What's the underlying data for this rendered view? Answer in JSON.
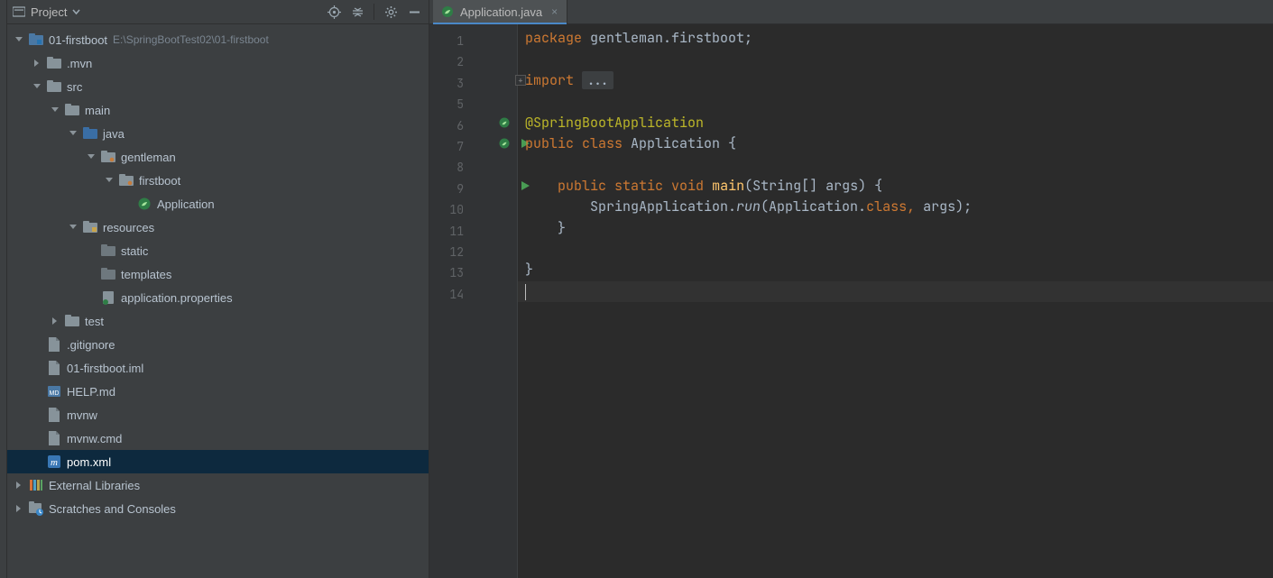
{
  "sidebar": {
    "title": "Project",
    "items": [
      {
        "depth": 0,
        "arrow": "down",
        "icon": "module",
        "label": "01-firstboot",
        "sub": "E:\\SpringBootTest02\\01-firstboot"
      },
      {
        "depth": 1,
        "arrow": "right",
        "icon": "folder",
        "label": ".mvn"
      },
      {
        "depth": 1,
        "arrow": "down",
        "icon": "folder",
        "label": "src"
      },
      {
        "depth": 2,
        "arrow": "down",
        "icon": "folder",
        "label": "main"
      },
      {
        "depth": 3,
        "arrow": "down",
        "icon": "src-folder",
        "label": "java"
      },
      {
        "depth": 4,
        "arrow": "down",
        "icon": "package",
        "label": "gentleman"
      },
      {
        "depth": 5,
        "arrow": "down",
        "icon": "package",
        "label": "firstboot"
      },
      {
        "depth": 6,
        "arrow": "none",
        "icon": "spring-class",
        "label": "Application"
      },
      {
        "depth": 3,
        "arrow": "down",
        "icon": "res-folder",
        "label": "resources"
      },
      {
        "depth": 4,
        "arrow": "none",
        "icon": "folder-dim",
        "label": "static"
      },
      {
        "depth": 4,
        "arrow": "none",
        "icon": "folder-dim",
        "label": "templates"
      },
      {
        "depth": 4,
        "arrow": "none",
        "icon": "spring-props",
        "label": "application.properties"
      },
      {
        "depth": 2,
        "arrow": "right",
        "icon": "folder",
        "label": "test"
      },
      {
        "depth": 1,
        "arrow": "none",
        "icon": "file",
        "label": ".gitignore"
      },
      {
        "depth": 1,
        "arrow": "none",
        "icon": "file",
        "label": "01-firstboot.iml"
      },
      {
        "depth": 1,
        "arrow": "none",
        "icon": "md",
        "label": "HELP.md"
      },
      {
        "depth": 1,
        "arrow": "none",
        "icon": "file",
        "label": "mvnw"
      },
      {
        "depth": 1,
        "arrow": "none",
        "icon": "file",
        "label": "mvnw.cmd"
      },
      {
        "depth": 1,
        "arrow": "none",
        "icon": "maven",
        "label": "pom.xml",
        "selected": true
      },
      {
        "depth": 0,
        "arrow": "right",
        "icon": "libs",
        "label": "External Libraries"
      },
      {
        "depth": 0,
        "arrow": "right",
        "icon": "scratch",
        "label": "Scratches and Consoles"
      }
    ]
  },
  "tab": {
    "file": "Application.java"
  },
  "code": {
    "lines": [
      1,
      2,
      3,
      5,
      6,
      7,
      8,
      9,
      10,
      11,
      12,
      13,
      14
    ],
    "l1": {
      "kw": "package ",
      "rest": "gentleman.firstboot;"
    },
    "l3": {
      "kw": "import ",
      "dots": "..."
    },
    "l6": {
      "ann": "@SpringBootApplication"
    },
    "l7": {
      "kw1": "public ",
      "kw2": "class ",
      "name": "Application ",
      "brace": "{"
    },
    "l9": {
      "kw1": "public ",
      "kw2": "static ",
      "kw3": "void ",
      "fn": "main",
      "args": "(String[] args) {"
    },
    "l10": {
      "call": "SpringApplication.",
      "it": "run",
      "rest": "(Application.",
      "kw": "class",
      ", comma": ", ",
      "args": "args);"
    },
    "l11": {
      "brace": "}"
    },
    "l13": {
      "brace": "}"
    }
  }
}
